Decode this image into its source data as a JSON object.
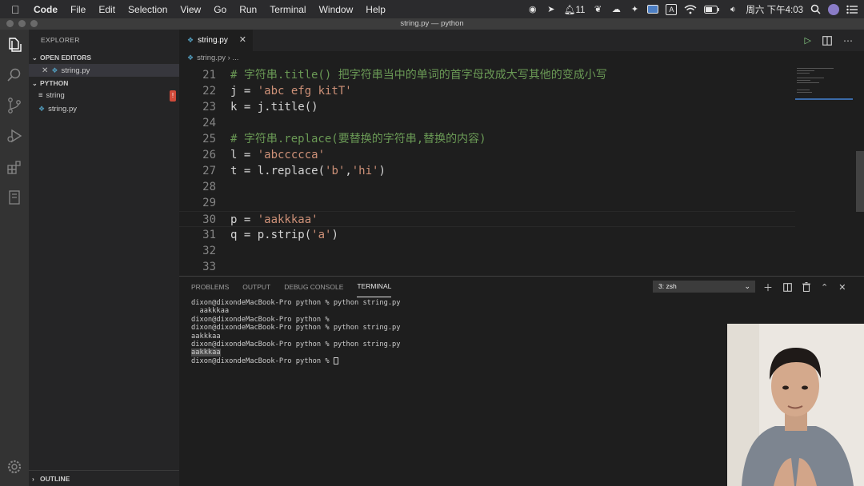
{
  "menubar": {
    "app": "Code",
    "items": [
      "File",
      "Edit",
      "Selection",
      "View",
      "Go",
      "Run",
      "Terminal",
      "Window",
      "Help"
    ],
    "notifications": "11",
    "clock": "周六 下午4:03",
    "input_method": "A"
  },
  "window": {
    "title": "string.py — python"
  },
  "sidebar": {
    "header": "EXPLORER",
    "open_editors_label": "OPEN EDITORS",
    "open_editors": [
      {
        "name": "string.py"
      }
    ],
    "folder_label": "PYTHON",
    "files": [
      {
        "name": "string",
        "icon": "text-file-icon",
        "badge": "!"
      },
      {
        "name": "string.py",
        "icon": "python-file-icon"
      }
    ],
    "outline_label": "OUTLINE"
  },
  "tabs": {
    "active": "string.py"
  },
  "breadcrumb": {
    "file": "string.py",
    "more": "..."
  },
  "editor": {
    "lines": [
      {
        "num": "21",
        "tokens": [
          {
            "t": "comment",
            "v": "# 字符串.title() 把字符串当中的单词的首字母改成大写其他的变成小写"
          }
        ]
      },
      {
        "num": "22",
        "tokens": [
          {
            "t": "plain",
            "v": "j = "
          },
          {
            "t": "str",
            "v": "'abc efg kitT'"
          }
        ]
      },
      {
        "num": "23",
        "tokens": [
          {
            "t": "plain",
            "v": "k = j.title()"
          }
        ]
      },
      {
        "num": "24",
        "tokens": []
      },
      {
        "num": "25",
        "tokens": [
          {
            "t": "comment",
            "v": "# 字符串.replace(要替换的字符串,替换的内容)"
          }
        ]
      },
      {
        "num": "26",
        "tokens": [
          {
            "t": "plain",
            "v": "l = "
          },
          {
            "t": "str",
            "v": "'abccccca'"
          }
        ]
      },
      {
        "num": "27",
        "tokens": [
          {
            "t": "plain",
            "v": "t = l.replace("
          },
          {
            "t": "str",
            "v": "'b'"
          },
          {
            "t": "plain",
            "v": ","
          },
          {
            "t": "str",
            "v": "'hi'"
          },
          {
            "t": "plain",
            "v": ")"
          }
        ]
      },
      {
        "num": "28",
        "tokens": []
      },
      {
        "num": "29",
        "tokens": []
      },
      {
        "num": "30",
        "tokens": [
          {
            "t": "plain",
            "v": "p = "
          },
          {
            "t": "str",
            "v": "'aakkkaa'"
          }
        ],
        "current": true
      },
      {
        "num": "31",
        "tokens": [
          {
            "t": "plain",
            "v": "q = p.strip("
          },
          {
            "t": "str",
            "v": "'a'"
          },
          {
            "t": "plain",
            "v": ")"
          }
        ]
      },
      {
        "num": "32",
        "tokens": []
      },
      {
        "num": "33",
        "tokens": []
      }
    ]
  },
  "panel": {
    "tabs": [
      "PROBLEMS",
      "OUTPUT",
      "DEBUG CONSOLE",
      "TERMINAL"
    ],
    "active_tab": "TERMINAL",
    "terminal_select": "3: zsh",
    "terminal_lines": [
      {
        "text": "dixon@dixondeMacBook-Pro python % python string.py"
      },
      {
        "text": "  aakkkaa"
      },
      {
        "text": "dixon@dixondeMacBook-Pro python %"
      },
      {
        "text": "dixon@dixondeMacBook-Pro python % python string.py"
      },
      {
        "text": "aakkkaa"
      },
      {
        "text": "dixon@dixondeMacBook-Pro python % python string.py"
      },
      {
        "text": "aakkkaa",
        "selected": true
      },
      {
        "text": "dixon@dixondeMacBook-Pro python % ",
        "cursor": true
      }
    ]
  },
  "colors": {
    "editor_bg": "#1e1e1e",
    "comment": "#6a9955",
    "string": "#ce9178",
    "python_icon": "#519aba",
    "error_badge": "#d04a3a"
  }
}
